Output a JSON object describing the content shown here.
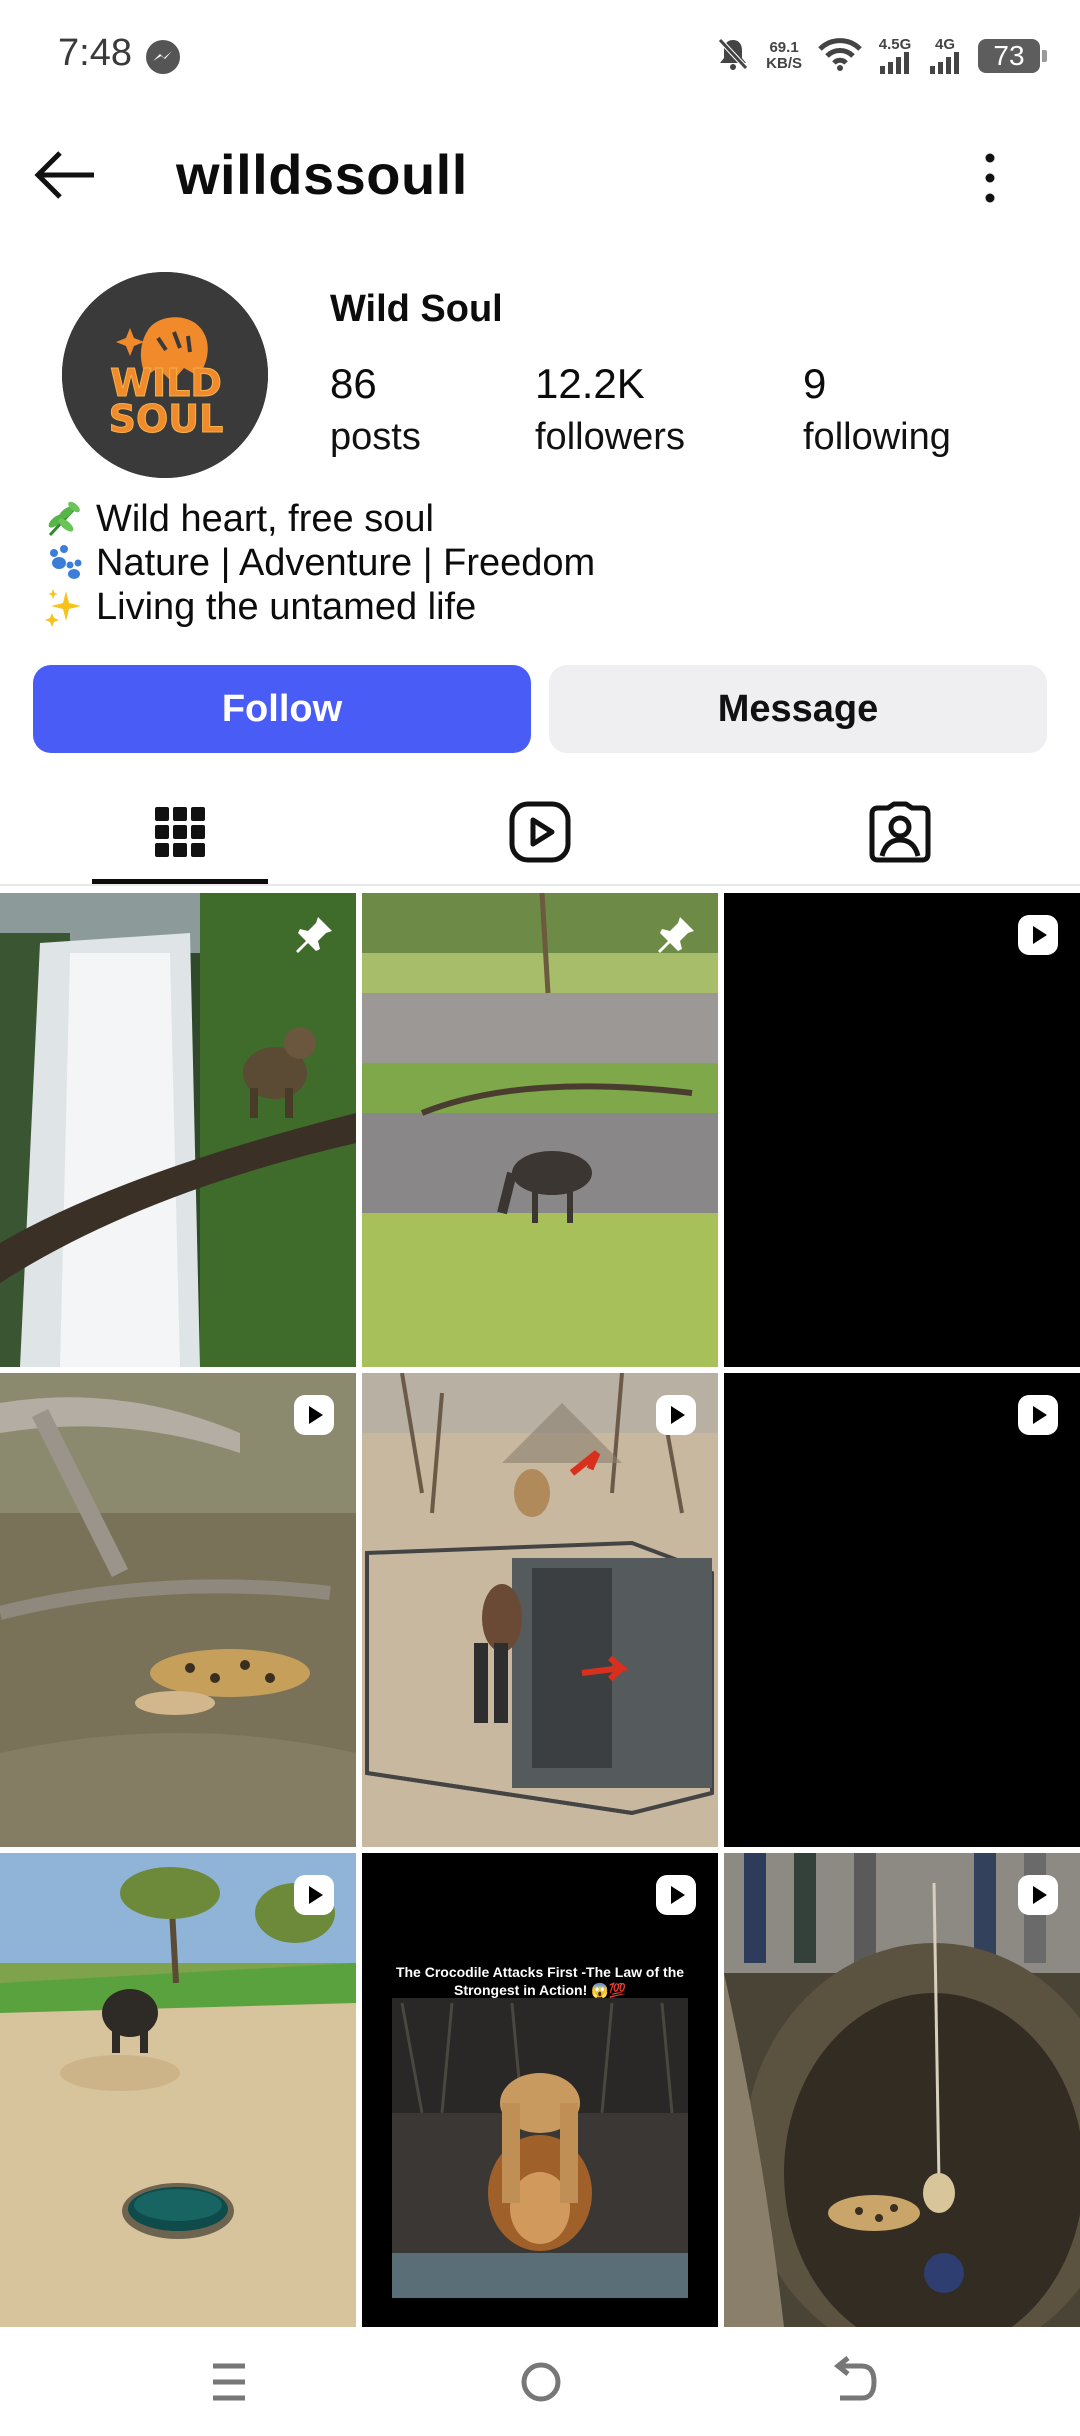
{
  "status_bar": {
    "time": "7:48",
    "net_speed_value": "69.1",
    "net_speed_unit": "KB/S",
    "signal1_label": "4.5G",
    "signal2_label": "4G",
    "battery": "73",
    "icons": [
      "messenger-icon",
      "mute-bell-icon",
      "wifi-icon",
      "signal-icon",
      "battery-icon"
    ]
  },
  "header": {
    "username": "willdssoull",
    "icons": [
      "back-arrow-icon",
      "more-vertical-icon"
    ]
  },
  "profile": {
    "display_name": "Wild Soul",
    "logo_text_line1": "WILD",
    "logo_text_line2": "SOUL",
    "stats": {
      "posts_value": "86",
      "posts_label": "posts",
      "followers_value": "12.2K",
      "followers_label": "followers",
      "following_value": "9",
      "following_label": "following"
    },
    "bio": [
      {
        "icon": "herb-emoji",
        "text": "Wild heart, free soul"
      },
      {
        "icon": "paw-prints-emoji",
        "text": "Nature | Adventure | Freedom"
      },
      {
        "icon": "sparkles-emoji",
        "text": "Living the untamed life"
      }
    ]
  },
  "actions": {
    "follow_label": "Follow",
    "message_label": "Message"
  },
  "tabs": [
    {
      "icon": "grid-icon",
      "selected": true
    },
    {
      "icon": "reels-icon",
      "selected": false
    },
    {
      "icon": "tagged-icon",
      "selected": false
    }
  ],
  "grid": {
    "posts": [
      {
        "scene": "waterfall-monkey",
        "badge": "pin-icon"
      },
      {
        "scene": "wildebeest-drinking",
        "badge": "pin-icon"
      },
      {
        "scene": "black",
        "badge": "reel-icon"
      },
      {
        "scene": "leopard-in-brush",
        "badge": "reel-icon"
      },
      {
        "scene": "lion-cage",
        "badge": "reel-icon"
      },
      {
        "scene": "black",
        "badge": "reel-icon"
      },
      {
        "scene": "buffalo-field",
        "badge": "reel-icon"
      },
      {
        "scene": "lion-drinking",
        "badge": "reel-icon",
        "caption": "The Crocodile Attacks First -The Law of the Strongest in Action! 😱💯"
      },
      {
        "scene": "leopard-well",
        "badge": "reel-icon"
      }
    ]
  },
  "nav_bar": {
    "icons": [
      "menu-icon",
      "home-circle-icon",
      "back-icon"
    ]
  },
  "colors": {
    "accent": "#4a5cf6",
    "secondary_button": "#efeff2",
    "avatar_bg": "#3a3a3a",
    "logo_orange": "#f08a2b"
  }
}
